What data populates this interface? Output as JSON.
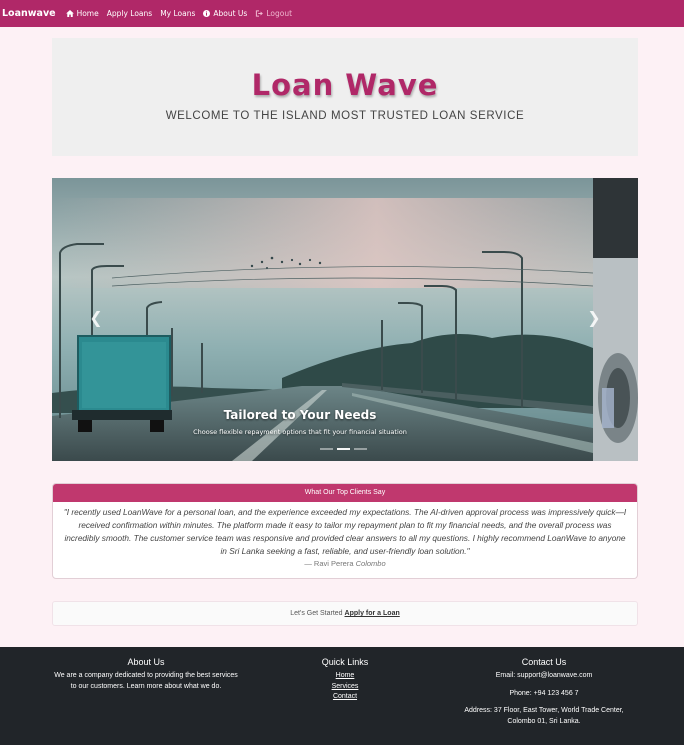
{
  "navbar": {
    "brand": "Loanwave",
    "items": [
      {
        "label": "Home",
        "icon": "home-icon"
      },
      {
        "label": "Apply Loans"
      },
      {
        "label": "My Loans"
      },
      {
        "label": "About Us",
        "icon": "info-icon"
      },
      {
        "label": "Logout",
        "icon": "logout-icon"
      }
    ]
  },
  "hero": {
    "title": "Loan Wave",
    "subtitle": "WELCOME TO THE ISLAND MOST TRUSTED LOAN SERVICE"
  },
  "carousel": {
    "caption_title": "Tailored to Your Needs",
    "caption_text": "Choose flexible repayment options that fit your financial situation",
    "prev_icon": "chevron-left-icon",
    "next_icon": "chevron-right-icon",
    "slide_count": 3,
    "active_slide": 2
  },
  "testimonial": {
    "header": "What Our Top Clients Say",
    "quote": "\"I recently used LoanWave for a personal loan, and the experience exceeded my expectations. The AI-driven approval process was impressively quick—I received confirmation within minutes. The platform made it easy to tailor my repayment plan to fit my financial needs, and the overall process was incredibly smooth. The customer service team was responsive and provided clear answers to all my questions. I highly recommend LoanWave to anyone in Sri Lanka seeking a fast, reliable, and user-friendly loan solution.\"",
    "author": "— Ravi Perera",
    "location": "Colombo"
  },
  "cta": {
    "text": "Let's Get Started",
    "link": "Apply for a Loan"
  },
  "footer": {
    "about": {
      "title": "About Us",
      "text": "We are a company dedicated to providing the best services to our customers. Learn more about what we do."
    },
    "links": {
      "title": "Quick Links",
      "items": [
        "Home",
        "Services",
        "Contact"
      ]
    },
    "contact": {
      "title": "Contact Us",
      "email": "Email: support@loanwave.com",
      "phone": "Phone: +94 123 456 7",
      "address": "Address: 37 Floor, East Tower, World Trade Center, Colombo 01, Sri Lanka."
    }
  },
  "colors": {
    "primary": "#b02868",
    "card_header": "#c0386e",
    "footer_bg": "#212529",
    "page_bg": "#fdf1f5",
    "hero_bg": "#efefef"
  }
}
